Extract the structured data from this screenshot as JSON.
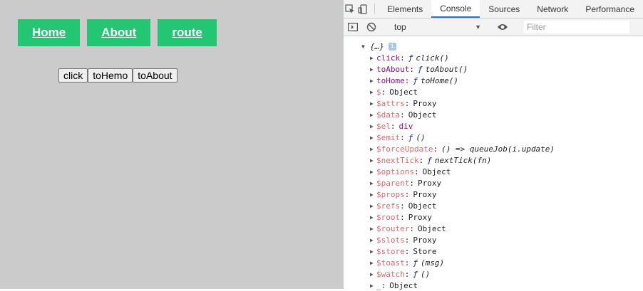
{
  "app": {
    "nav": [
      {
        "label": "Home"
      },
      {
        "label": "About"
      },
      {
        "label": "route"
      }
    ],
    "buttons": [
      {
        "label": "click"
      },
      {
        "label": "toHemo"
      },
      {
        "label": "toAbout"
      }
    ],
    "colors": {
      "background": "#cbcbcb",
      "nav_bg": "#23c673"
    }
  },
  "devtools": {
    "tabs": [
      "Elements",
      "Console",
      "Sources",
      "Network",
      "Performance"
    ],
    "active_tab": "Console",
    "context": "top",
    "filter_placeholder": "Filter",
    "object_preview": "{…}",
    "properties": [
      {
        "key": "click",
        "value": "click()",
        "kind": "fn"
      },
      {
        "key": "toAbout",
        "value": "toAbout()",
        "kind": "fn"
      },
      {
        "key": "toHome",
        "value": "toHome()",
        "kind": "fn"
      },
      {
        "key": "$",
        "value": "Object",
        "kind": "obj"
      },
      {
        "key": "$attrs",
        "value": "Proxy",
        "kind": "obj"
      },
      {
        "key": "$data",
        "value": "Object",
        "kind": "obj"
      },
      {
        "key": "$el",
        "value": "div",
        "kind": "el"
      },
      {
        "key": "$emit",
        "value": "()",
        "kind": "fn"
      },
      {
        "key": "$forceUpdate",
        "value": "() => queueJob(i.update)",
        "kind": "arrow"
      },
      {
        "key": "$nextTick",
        "value": "nextTick(fn)",
        "kind": "fn"
      },
      {
        "key": "$options",
        "value": "Object",
        "kind": "obj"
      },
      {
        "key": "$parent",
        "value": "Proxy",
        "kind": "obj"
      },
      {
        "key": "$props",
        "value": "Proxy",
        "kind": "obj"
      },
      {
        "key": "$refs",
        "value": "Object",
        "kind": "obj"
      },
      {
        "key": "$root",
        "value": "Proxy",
        "kind": "obj"
      },
      {
        "key": "$router",
        "value": "Object",
        "kind": "obj"
      },
      {
        "key": "$slots",
        "value": "Proxy",
        "kind": "obj"
      },
      {
        "key": "$store",
        "value": "Store",
        "kind": "obj"
      },
      {
        "key": "$toast",
        "value": "(msg)",
        "kind": "fn"
      },
      {
        "key": "$watch",
        "value": "()",
        "kind": "fn"
      },
      {
        "key": "_",
        "value": "Object",
        "kind": "plain"
      }
    ]
  }
}
